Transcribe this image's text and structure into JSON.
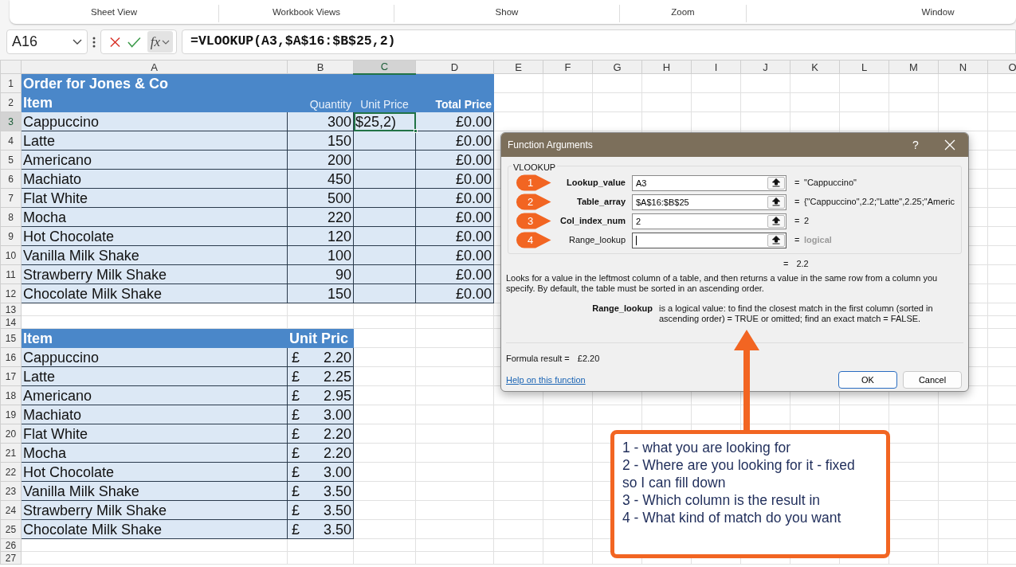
{
  "ribbon_groups": [
    "Sheet View",
    "Workbook Views",
    "Show",
    "Zoom",
    "Window"
  ],
  "formula_bar": {
    "name_box": "A16",
    "function_button": "fx",
    "formula": "=VLOOKUP(A3,$A$16:$B$25,2)"
  },
  "sheet": {
    "columns": [
      {
        "label": "A",
        "selected": false
      },
      {
        "label": "B",
        "selected": false
      },
      {
        "label": "C",
        "selected": true
      },
      {
        "label": "D",
        "selected": false
      },
      {
        "label": "E",
        "selected": false
      },
      {
        "label": "F",
        "selected": false
      },
      {
        "label": "G",
        "selected": false
      },
      {
        "label": "H",
        "selected": false
      },
      {
        "label": "I",
        "selected": false
      },
      {
        "label": "J",
        "selected": false
      },
      {
        "label": "K",
        "selected": false
      },
      {
        "label": "L",
        "selected": false
      },
      {
        "label": "M",
        "selected": false
      },
      {
        "label": "N",
        "selected": false
      },
      {
        "label": "O",
        "selected": false
      }
    ],
    "rows": [
      {
        "number": "1",
        "selected": false,
        "kind": "title",
        "title": "Order for Jones & Co"
      },
      {
        "number": "2",
        "selected": false,
        "kind": "header",
        "item": "Item",
        "quantity": "Quantity",
        "unit_price": "Unit Price",
        "total": "Total Price"
      },
      {
        "number": "3",
        "selected": true,
        "kind": "order",
        "item": "Cappuccino",
        "quantity": "300",
        "unit_price": "$25,2)",
        "active": true,
        "total": "£0.00"
      },
      {
        "number": "4",
        "selected": false,
        "kind": "order",
        "item": "Latte",
        "quantity": "150",
        "active": false,
        "total": "£0.00"
      },
      {
        "number": "5",
        "selected": false,
        "kind": "order",
        "item": "Americano",
        "quantity": "200",
        "active": false,
        "total": "£0.00"
      },
      {
        "number": "6",
        "selected": false,
        "kind": "order",
        "item": "Machiato",
        "quantity": "450",
        "active": false,
        "total": "£0.00"
      },
      {
        "number": "7",
        "selected": false,
        "kind": "order",
        "item": "Flat White",
        "quantity": "500",
        "active": false,
        "total": "£0.00"
      },
      {
        "number": "8",
        "selected": false,
        "kind": "order",
        "item": "Mocha",
        "quantity": "220",
        "active": false,
        "total": "£0.00"
      },
      {
        "number": "9",
        "selected": false,
        "kind": "order",
        "item": "Hot Chocolate",
        "quantity": "120",
        "active": false,
        "total": "£0.00"
      },
      {
        "number": "10",
        "selected": false,
        "kind": "order",
        "item": "Vanilla Milk Shake",
        "quantity": "100",
        "active": false,
        "total": "£0.00"
      },
      {
        "number": "11",
        "selected": false,
        "kind": "order",
        "item": "Strawberry Milk Shake",
        "quantity": "90",
        "active": false,
        "total": "£0.00"
      },
      {
        "number": "12",
        "selected": false,
        "kind": "order",
        "item": "Chocolate  Milk Shake",
        "quantity": "150",
        "active": false,
        "total": "£0.00"
      },
      {
        "number": "13",
        "selected": false,
        "kind": "blank"
      },
      {
        "number": "14",
        "selected": false,
        "kind": "blank"
      },
      {
        "number": "15",
        "selected": false,
        "kind": "price_header",
        "item": "Item",
        "price": "Unit Pric"
      },
      {
        "number": "16",
        "selected": false,
        "kind": "price",
        "item": "Cappuccino",
        "currency": "£",
        "price": "2.20"
      },
      {
        "number": "17",
        "selected": false,
        "kind": "price",
        "item": "Latte",
        "currency": "£",
        "price": "2.25"
      },
      {
        "number": "18",
        "selected": false,
        "kind": "price",
        "item": "Americano",
        "currency": "£",
        "price": "2.95"
      },
      {
        "number": "19",
        "selected": false,
        "kind": "price",
        "item": "Machiato",
        "currency": "£",
        "price": "3.00"
      },
      {
        "number": "20",
        "selected": false,
        "kind": "price",
        "item": "Flat White",
        "currency": "£",
        "price": "2.20"
      },
      {
        "number": "21",
        "selected": false,
        "kind": "price",
        "item": "Mocha",
        "currency": "£",
        "price": "2.20"
      },
      {
        "number": "22",
        "selected": false,
        "kind": "price",
        "item": "Hot Chocolate",
        "currency": "£",
        "price": "3.00"
      },
      {
        "number": "23",
        "selected": false,
        "kind": "price",
        "item": "Vanilla Milk Shake",
        "currency": "£",
        "price": "3.50"
      },
      {
        "number": "24",
        "selected": false,
        "kind": "price",
        "item": "Strawberry Milk Shake",
        "currency": "£",
        "price": "3.50"
      },
      {
        "number": "25",
        "selected": false,
        "kind": "price",
        "item": "Chocolate  Milk Shake",
        "currency": "£",
        "price": "3.50"
      },
      {
        "number": "26",
        "selected": false,
        "kind": "blank"
      },
      {
        "number": "27",
        "selected": false,
        "kind": "blank"
      }
    ]
  },
  "dialog": {
    "title": "Function Arguments",
    "help_button": "?",
    "function_name": "VLOOKUP",
    "arguments": [
      {
        "marker": "1",
        "label": "Lookup_value",
        "required": true,
        "value": "A3",
        "focused": false,
        "equals": "=",
        "result": "\"Cappuccino\""
      },
      {
        "marker": "2",
        "label": "Table_array",
        "required": true,
        "value": "$A$16:$B$25",
        "focused": false,
        "equals": "=",
        "result": "{\"Cappuccino\",2.2;\"Latte\",2.25;\"Americ"
      },
      {
        "marker": "3",
        "label": "Col_index_num",
        "required": true,
        "value": "2",
        "focused": false,
        "equals": "=",
        "result": "2"
      },
      {
        "marker": "4",
        "label": "Range_lookup",
        "required": false,
        "focused": true,
        "equals": "=",
        "result": "logical"
      }
    ],
    "overall_equals": "=",
    "overall_result": "2.2",
    "description": "Looks for a value in the leftmost column of a table, and then returns a value in the same row from a column you specify. By default, the table must be sorted in an ascending order.",
    "argument_help": {
      "label": "Range_lookup",
      "text": "is a logical value: to find the closest match in the first column (sorted in ascending order) = TRUE or omitted; find an exact match = FALSE."
    },
    "formula_result_label": "Formula result =",
    "formula_result": "£2.20",
    "help_link": "Help on this function",
    "buttons": [
      {
        "label": "OK",
        "default": true
      },
      {
        "label": "Cancel",
        "default": false
      }
    ]
  },
  "annotation": {
    "lines": [
      "1 - what you are looking for",
      "2 - Where are you looking for it - fixed so I can fill down",
      "3 - Which column is the result in",
      "4 - What kind of match do you want"
    ]
  }
}
